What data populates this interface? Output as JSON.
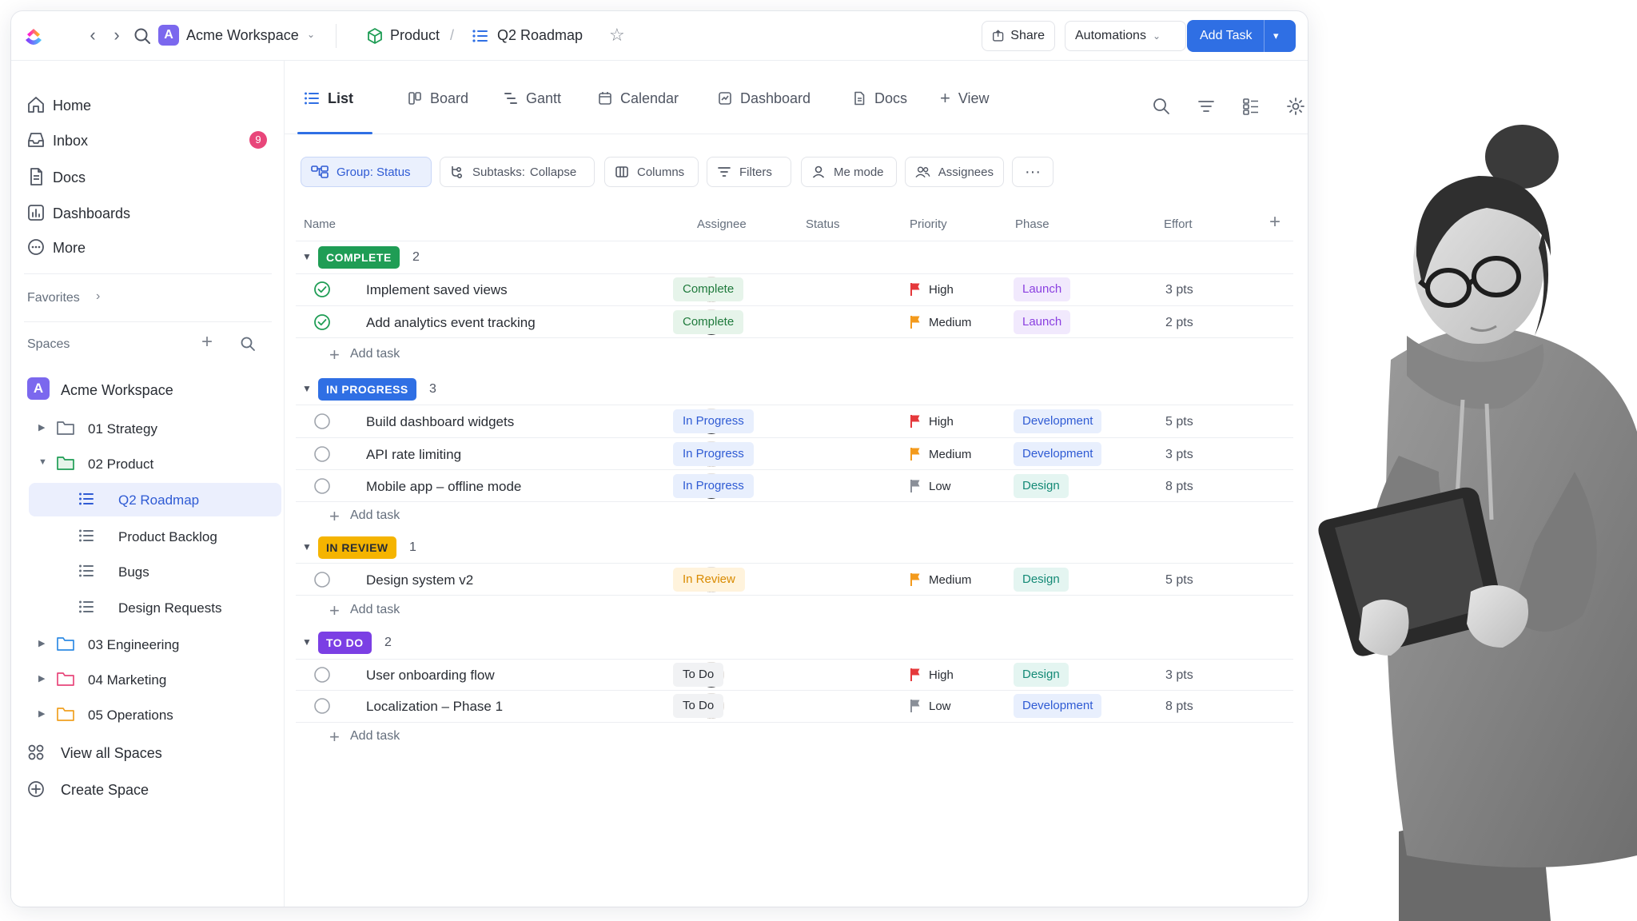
{
  "window": {
    "workspace_badge": "A",
    "workspace_name": "Acme Workspace",
    "breadcrumb": [
      "Product",
      "Q2 Roadmap"
    ],
    "breadcrumb_sep": "/"
  },
  "toolbar": {
    "share": "Share",
    "automations": "Automations",
    "add_task": "Add Task"
  },
  "sidebar": {
    "nav": [
      {
        "label": "Home",
        "icon": "home-icon"
      },
      {
        "label": "Inbox",
        "icon": "inbox-icon",
        "badge": "9"
      },
      {
        "label": "Docs",
        "icon": "docs-icon"
      },
      {
        "label": "Dashboards",
        "icon": "dashboards-icon"
      },
      {
        "label": "More",
        "icon": "more-icon"
      }
    ],
    "favorites": "Favorites",
    "spaces": "Spaces",
    "space_badge": "A",
    "space_name": "Acme Workspace",
    "folders": [
      {
        "label": "01 Strategy",
        "color": "#656f7d",
        "expanded": false
      },
      {
        "label": "02 Product",
        "color": "#1f9d55",
        "expanded": true
      },
      {
        "label": "03 Engineering",
        "color": "#2f8be4",
        "expanded": false
      },
      {
        "label": "04 Marketing",
        "color": "#e8467a",
        "expanded": false
      },
      {
        "label": "05 Operations",
        "color": "#f0a020",
        "expanded": false
      }
    ],
    "lists": [
      "Q2 Roadmap",
      "Product Backlog",
      "Bugs",
      "Design Requests"
    ],
    "view_all": "View all Spaces",
    "create_space": "Create Space"
  },
  "tabs": [
    "List",
    "Board",
    "Gantt",
    "Calendar",
    "Dashboard",
    "Docs",
    "View"
  ],
  "chips": {
    "group": "Group: Status",
    "subtasks_label": "Subtasks:",
    "subtasks_value": "Collapse",
    "columns": "Columns",
    "filters": "Filters",
    "me_mode": "Me mode",
    "assignees": "Assignees",
    "more": "···"
  },
  "columns": [
    "Name",
    "Assignee",
    "Status",
    "Priority",
    "Phase",
    "Effort"
  ],
  "add_task_label": "Add task",
  "colors": {
    "accent": "#2f6fe4",
    "complete": "#1f9d55",
    "in_progress": "#2f6fe4",
    "in_review": "#f5b400",
    "to_do": "#7b3fe4",
    "flag_high": "#e5383b",
    "flag_medium": "#f39a1c",
    "flag_low": "#8a8f98"
  },
  "groups": [
    {
      "label": "COMPLETE",
      "count": "2",
      "color": "#1f9d55",
      "text": "#ffffff",
      "tasks": [
        {
          "name": "Implement saved views",
          "done": true,
          "avatar": "female",
          "status": "Complete",
          "status_class": "st-complete",
          "priority": "High",
          "flag": "#e5383b",
          "phase": "Launch",
          "phase_class": "ph-launch",
          "effort": "3 pts"
        },
        {
          "name": "Add analytics event tracking",
          "done": true,
          "avatar": "male",
          "status": "Complete",
          "status_class": "st-complete",
          "priority": "Medium",
          "flag": "#f39a1c",
          "phase": "Launch",
          "phase_class": "ph-launch",
          "effort": "2 pts"
        }
      ]
    },
    {
      "label": "IN PROGRESS",
      "count": "3",
      "color": "#2f6fe4",
      "text": "#ffffff",
      "tasks": [
        {
          "name": "Build dashboard widgets",
          "done": false,
          "avatar": "male",
          "status": "In Progress",
          "status_class": "st-progress",
          "priority": "High",
          "flag": "#e5383b",
          "phase": "Development",
          "phase_class": "ph-dev",
          "effort": "5 pts"
        },
        {
          "name": "API rate limiting",
          "done": false,
          "avatar": "female",
          "status": "In Progress",
          "status_class": "st-progress",
          "priority": "Medium",
          "flag": "#f39a1c",
          "phase": "Development",
          "phase_class": "ph-dev",
          "effort": "3 pts"
        },
        {
          "name": "Mobile app – offline mode",
          "done": false,
          "avatar": "male",
          "status": "In Progress",
          "status_class": "st-progress",
          "priority": "Low",
          "flag": "#8a8f98",
          "phase": "Design",
          "phase_class": "ph-design",
          "effort": "8 pts"
        }
      ]
    },
    {
      "label": "IN REVIEW",
      "count": "1",
      "color": "#f5b400",
      "text": "#292d34",
      "tasks": [
        {
          "name": "Design system v2",
          "done": false,
          "avatar": "female",
          "status": "In Review",
          "status_class": "st-review",
          "priority": "Medium",
          "flag": "#f39a1c",
          "phase": "Design",
          "phase_class": "ph-design",
          "effort": "5 pts"
        }
      ]
    },
    {
      "label": "TO DO",
      "count": "2",
      "color": "#7b3fe4",
      "text": "#ffffff",
      "tasks": [
        {
          "name": "User onboarding flow",
          "done": false,
          "avatar": "male",
          "status": "To Do",
          "status_class": "st-todo",
          "priority": "High",
          "flag": "#e5383b",
          "phase": "Design",
          "phase_class": "ph-design",
          "effort": "3 pts"
        },
        {
          "name": "Localization – Phase 1",
          "done": false,
          "avatar": "female",
          "status": "To Do",
          "status_class": "st-todo",
          "priority": "Low",
          "flag": "#8a8f98",
          "phase": "Development",
          "phase_class": "ph-dev",
          "effort": "8 pts"
        }
      ]
    }
  ]
}
